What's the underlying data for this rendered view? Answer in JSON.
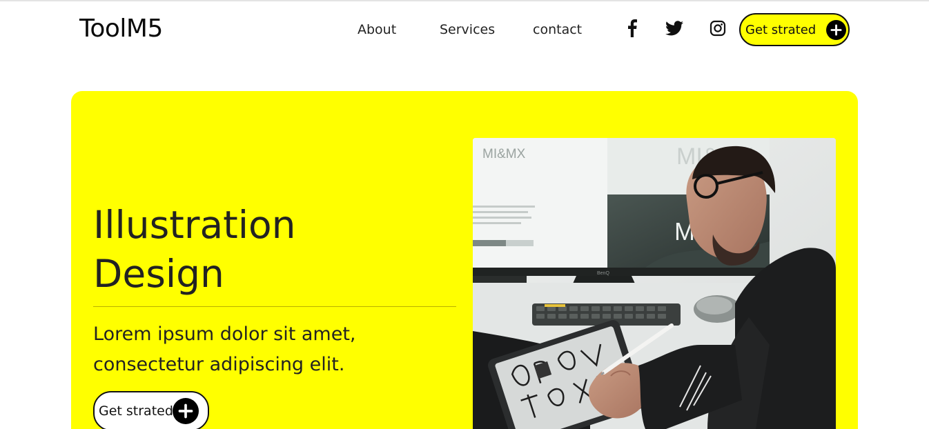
{
  "header": {
    "logo": "ToolM5",
    "nav": [
      {
        "label": "About"
      },
      {
        "label": "Services"
      },
      {
        "label": "contact"
      }
    ],
    "social_icons": [
      "facebook-icon",
      "twitter-icon",
      "instagram-icon"
    ],
    "cta_label": "Get strated"
  },
  "hero": {
    "title_line1": "Illustration",
    "title_line2": "Design",
    "text_line1": "Lorem ipsum dolor sit amet,",
    "text_line2": "consectetur adipiscing elit.",
    "cta_label": "Get strated",
    "image": {
      "monitor_text_left": "MI&MX",
      "monitor_text_right_top": "MI&MX",
      "monitor_text_right": "MI&M",
      "monitor_brand": "BenQ"
    }
  },
  "colors": {
    "accent": "#ffff00",
    "text": "#222222",
    "button_border": "#111111"
  }
}
